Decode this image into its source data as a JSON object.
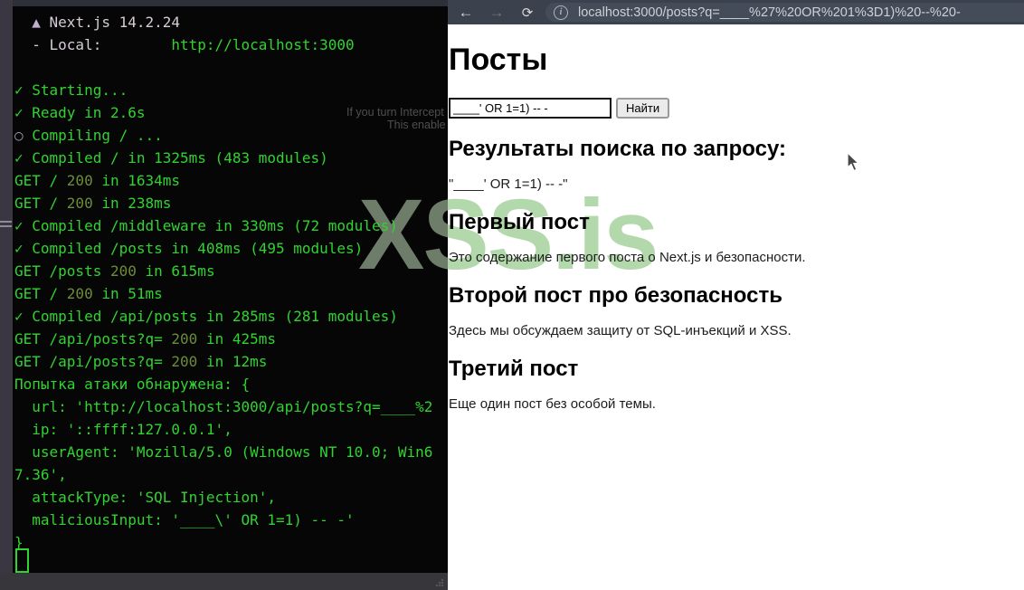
{
  "terminal": {
    "lines": [
      [
        {
          "t": "  ",
          "c": "g"
        },
        {
          "t": "▲",
          "c": "t"
        },
        {
          "t": " Next.js 14.2.24",
          "c": "w"
        }
      ],
      [
        {
          "t": "  - Local:        ",
          "c": "w"
        },
        {
          "t": "http://localhost:3000",
          "c": "g"
        }
      ],
      [],
      [
        {
          "t": "✓ Starting...",
          "c": "g"
        }
      ],
      [
        {
          "t": "✓ Ready in 2.6s",
          "c": "g"
        }
      ],
      [
        {
          "t": "○",
          "c": "c"
        },
        {
          "t": " Compiling / ...",
          "c": "g"
        }
      ],
      [
        {
          "t": "✓ Compiled / in 1325ms (483 modules)",
          "c": "g"
        }
      ],
      [
        {
          "t": "GET / ",
          "c": "g"
        },
        {
          "t": "200",
          "c": "o"
        },
        {
          "t": " in 1634ms",
          "c": "g"
        }
      ],
      [
        {
          "t": "GET / ",
          "c": "g"
        },
        {
          "t": "200",
          "c": "o"
        },
        {
          "t": " in 238ms",
          "c": "g"
        }
      ],
      [
        {
          "t": "✓ Compiled /middleware in 330ms (72 modules)",
          "c": "g"
        }
      ],
      [
        {
          "t": "✓ Compiled /posts in 408ms (495 modules)",
          "c": "g"
        }
      ],
      [
        {
          "t": "GET /posts ",
          "c": "g"
        },
        {
          "t": "200",
          "c": "o"
        },
        {
          "t": " in 615ms",
          "c": "g"
        }
      ],
      [
        {
          "t": "GET / ",
          "c": "g"
        },
        {
          "t": "200",
          "c": "o"
        },
        {
          "t": " in 51ms",
          "c": "g"
        }
      ],
      [
        {
          "t": "✓ Compiled /api/posts in 285ms (281 modules)",
          "c": "g"
        }
      ],
      [
        {
          "t": "GET /api/posts?q= ",
          "c": "g"
        },
        {
          "t": "200",
          "c": "o"
        },
        {
          "t": " in 425ms",
          "c": "g"
        }
      ],
      [
        {
          "t": "GET /api/posts?q= ",
          "c": "g"
        },
        {
          "t": "200",
          "c": "o"
        },
        {
          "t": " in 12ms",
          "c": "g"
        }
      ],
      [
        {
          "t": "Попытка атаки обнаружена: {",
          "c": "g"
        }
      ],
      [
        {
          "t": "  url: 'http://localhost:3000/api/posts?q=____%2",
          "c": "g"
        }
      ],
      [
        {
          "t": "  ip: '::ffff:127.0.0.1',",
          "c": "g"
        }
      ],
      [
        {
          "t": "  userAgent: 'Mozilla/5.0 (Windows NT 10.0; Win6",
          "c": "g"
        }
      ],
      [
        {
          "t": "7.36',",
          "c": "g"
        }
      ],
      [
        {
          "t": "  attackType: 'SQL Injection',",
          "c": "g"
        }
      ],
      [
        {
          "t": "  maliciousInput: '____\\' OR 1=1) -- -'",
          "c": "g"
        }
      ],
      [
        {
          "t": "}",
          "c": "g"
        }
      ]
    ],
    "colors": {
      "green": "#31d331",
      "olive": "#6d8c3a",
      "foreground": "#d6cdd6"
    }
  },
  "browser": {
    "url": "localhost:3000/posts?q=____%27%20OR%201%3D1)%20--%20-",
    "back_icon": "←",
    "forward_icon": "→",
    "reload_icon": "⟳",
    "info_icon": "i"
  },
  "page": {
    "title": "Посты",
    "search": {
      "value": "____' OR 1=1) -- -",
      "button_label": "Найти"
    },
    "results_heading": "Результаты поиска по запросу:",
    "query_echo": "\"____' OR 1=1) -- -\"",
    "posts": [
      {
        "title": "Первый пост",
        "body": "Это содержание первого поста о Next.js и безопасности."
      },
      {
        "title": "Второй пост про безопасность",
        "body": "Здесь мы обсуждаем защиту от SQL-инъекций и XSS."
      },
      {
        "title": "Третий пост",
        "body": "Еще один пост без особой темы."
      }
    ]
  },
  "watermark": {
    "text": "XSS.is",
    "line1": "If you turn Intercept",
    "line2": "This enable",
    "color_on_dark": "#6e7d6a",
    "color_on_light": "#b3d8ab"
  }
}
